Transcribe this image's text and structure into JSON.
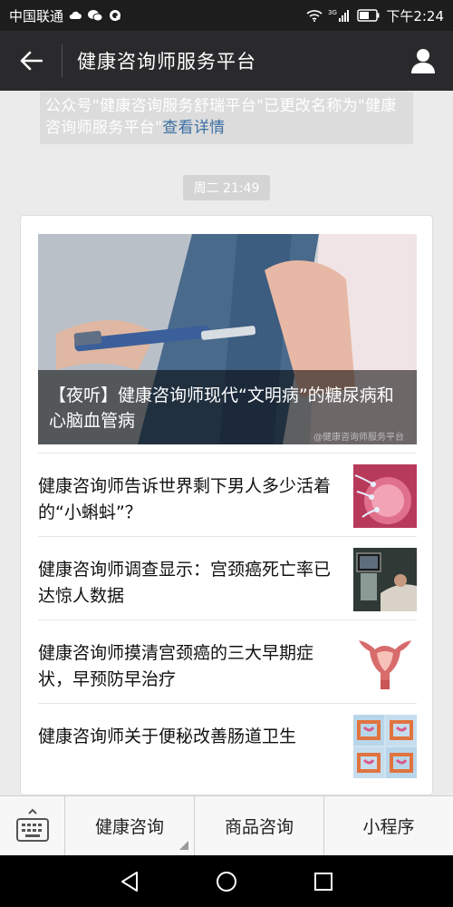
{
  "status_bar": {
    "carrier": "中国联通",
    "network": "3G",
    "time": "下午2:24",
    "icons": [
      "cloud-icon",
      "wechat-icon",
      "qq-icon",
      "wifi-icon",
      "signal-icon",
      "battery-icon"
    ]
  },
  "header": {
    "title": "健康咨询师服务平台",
    "back_icon": "back-arrow-icon",
    "profile_icon": "person-icon"
  },
  "notice": {
    "text": "公众号\"健康咨询服务舒瑞平台\"已更改名称为\"健康咨询师服务平台\"",
    "link_label": "查看详情"
  },
  "message_time": "周二 21:49",
  "hero_article": {
    "title": "【夜听】健康咨询师现代“文明病”的糖尿病和心脑血管病",
    "watermark": "@健康咨询师服务平台"
  },
  "articles": [
    {
      "title": "健康咨询师告诉世界剩下男人多少活着的“小蝌蚪”？",
      "thumb": "sperm-cell-image"
    },
    {
      "title": "健康咨询师调查显示：宫颈癌死亡率已达惊人数据",
      "thumb": "medical-exam-image"
    },
    {
      "title": "健康咨询师摸清宫颈癌的三大早期症状，早预防早治疗",
      "thumb": "uterus-diagram-image"
    },
    {
      "title": "健康咨询师关于便秘改善肠道卫生",
      "thumb": "intestine-diagram-image"
    }
  ],
  "bottom_menu": {
    "keyboard_icon": "keyboard-icon",
    "items": [
      "健康咨询",
      "商品咨询",
      "小程序"
    ]
  },
  "nav_bar": {
    "icons": [
      "back-triangle-icon",
      "home-circle-icon",
      "recents-square-icon"
    ]
  },
  "colors": {
    "header_bg": "#2a2a2c",
    "status_bg": "#1d1d1d",
    "link": "#3d6fa3",
    "page_bg": "#ebebeb"
  }
}
